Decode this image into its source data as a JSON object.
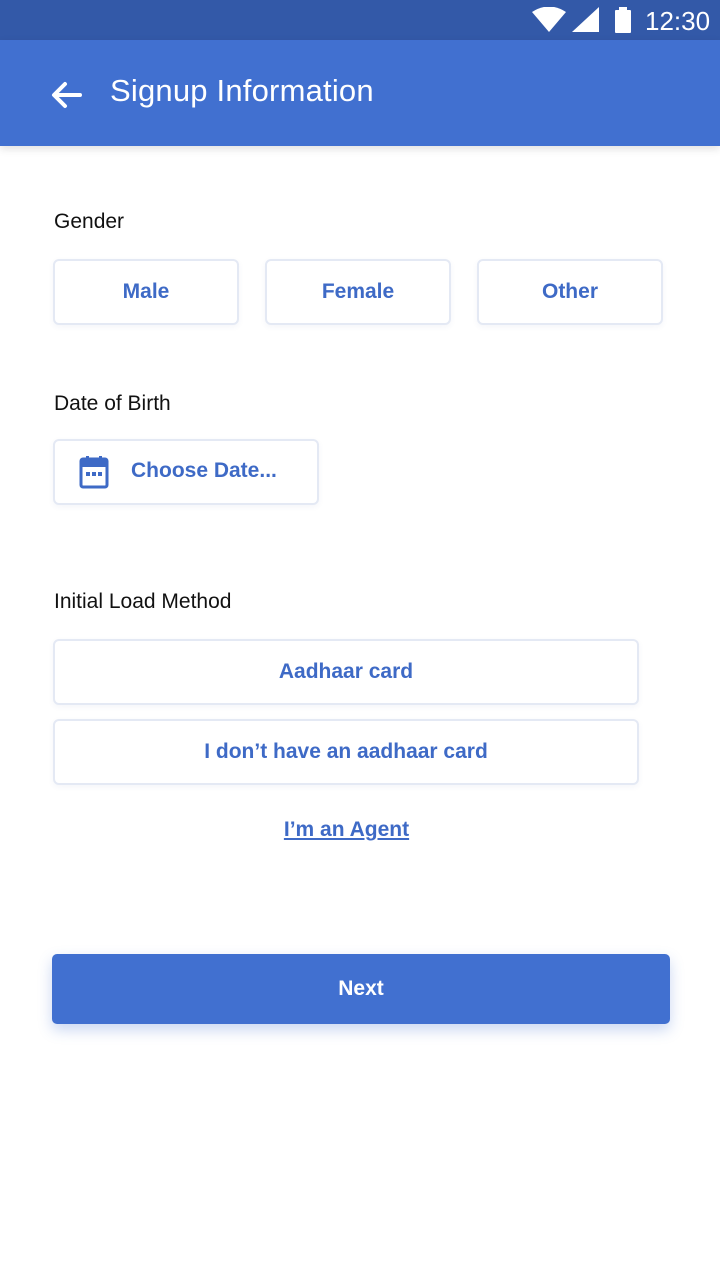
{
  "status_bar": {
    "time": "12:30",
    "icons": [
      "wifi-icon",
      "signal-icon",
      "battery-icon"
    ]
  },
  "app_bar": {
    "title": "Signup Information",
    "back_icon": "arrow-left-icon",
    "color": "#4170d0"
  },
  "gender": {
    "label": "Gender",
    "options": [
      "Male",
      "Female",
      "Other"
    ]
  },
  "dob": {
    "label": "Date of Birth",
    "button_label": "Choose Date...",
    "icon": "calendar-icon"
  },
  "load_method": {
    "label": "Initial Load Method",
    "options": [
      "Aadhaar card",
      "I don’t have an aadhaar card"
    ]
  },
  "agent_link": "I’m an Agent",
  "next_button": "Next",
  "colors": {
    "status_bar": "#3359a8",
    "accent": "#4170d0",
    "accent_text": "#3e6ac6"
  }
}
